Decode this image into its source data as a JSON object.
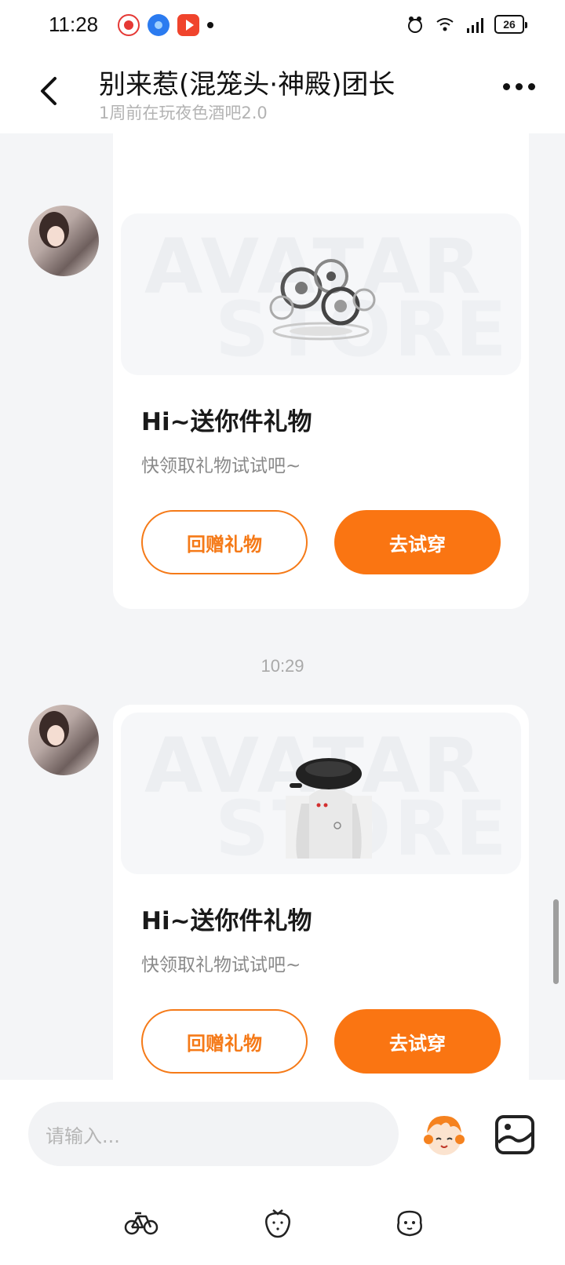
{
  "status_bar": {
    "time": "11:28",
    "battery": "26"
  },
  "header": {
    "title": "别来惹(混笼头·神殿)团长",
    "subtitle": "1周前在玩夜色酒吧2.0"
  },
  "messages": [
    {
      "type": "gift_card",
      "banner_watermark_1": "AVATAR",
      "banner_watermark_2": "STORE",
      "title": "Hi~送你件礼物",
      "description": "快领取礼物试试吧~",
      "return_gift_label": "回赠礼物",
      "try_on_label": "去试穿"
    },
    {
      "type": "gift_card",
      "banner_watermark_1": "AVATAR",
      "banner_watermark_2": "STORE",
      "title": "Hi~送你件礼物",
      "description": "快领取礼物试试吧~",
      "return_gift_label": "回赠礼物",
      "try_on_label": "去试穿"
    }
  ],
  "timestamp": "10:29",
  "input": {
    "placeholder": "请输入..."
  },
  "colors": {
    "accent": "#fa7512",
    "background": "#f4f5f7"
  },
  "icons": [
    "back-icon",
    "more-icon",
    "sticker-icon",
    "image-icon",
    "bicycle-icon",
    "strawberry-icon",
    "pet-icon"
  ]
}
